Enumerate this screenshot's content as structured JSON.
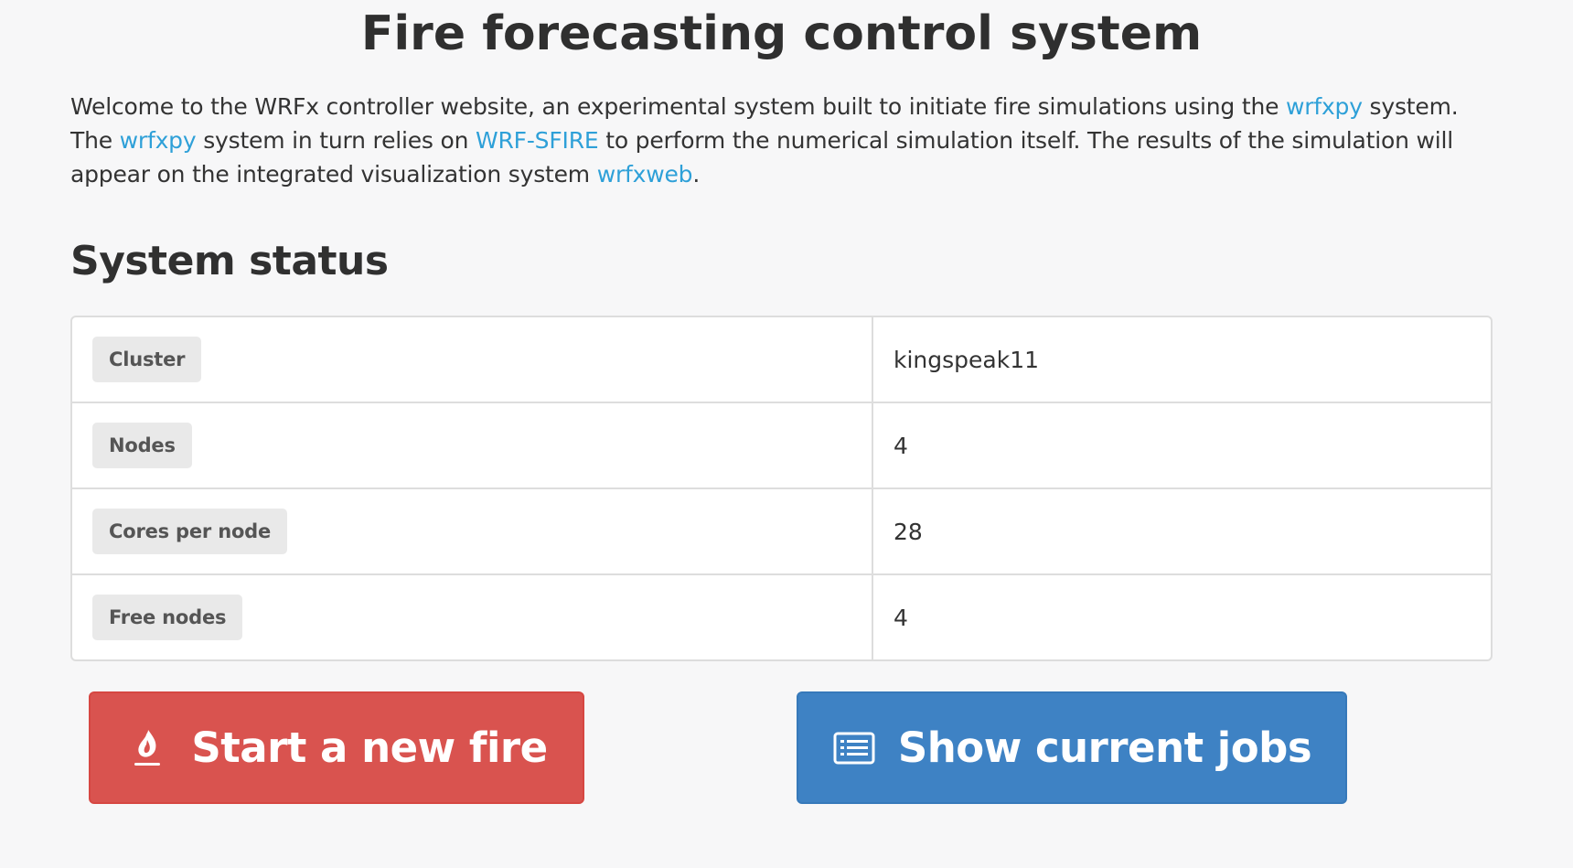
{
  "page": {
    "title": "Fire forecasting control system",
    "intro": {
      "line1_text": "Welcome to the WRFx controller website, an experimental system built to initiate fire simulations using the ",
      "line1_link": "wrfxpy",
      "line1_tail": " system.",
      "line2_head": "The ",
      "line2_link1": "wrfxpy",
      "line2_mid1": " system in turn relies on ",
      "line2_link2": "WRF-SFIRE",
      "line2_tail": " to perform the numerical simulation itself. The results of the simulation will",
      "line3_head": "appear on the integrated visualization system ",
      "line3_link": "wrfxweb",
      "line3_tail": "."
    },
    "status_heading": "System status"
  },
  "status": {
    "rows": [
      {
        "label": "Cluster",
        "value": "kingspeak11"
      },
      {
        "label": "Nodes",
        "value": "4"
      },
      {
        "label": "Cores per node",
        "value": "28"
      },
      {
        "label": "Free nodes",
        "value": "4"
      }
    ]
  },
  "actions": {
    "start_fire": {
      "label": "Start a new fire",
      "icon": "fire-icon",
      "color": "#d9534f"
    },
    "show_jobs": {
      "label": "Show current jobs",
      "icon": "list-icon",
      "color": "#3e82c4"
    }
  },
  "theme": {
    "link_color": "#2ea0d8",
    "background": "#f7f7f8"
  }
}
